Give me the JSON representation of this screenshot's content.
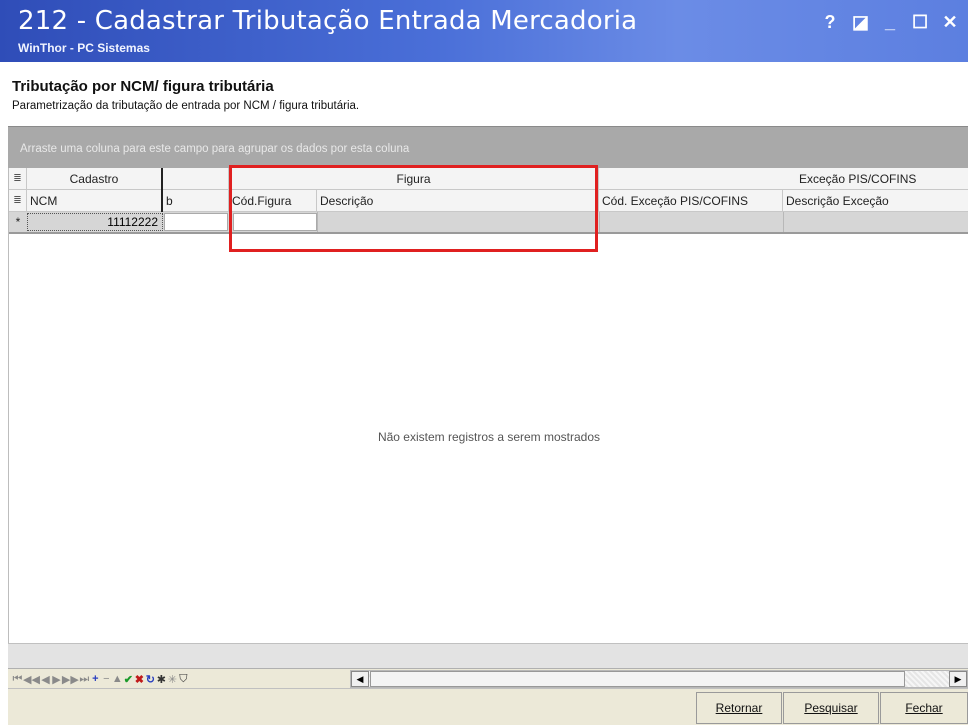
{
  "window": {
    "title": "212 - Cadastrar Tributação Entrada Mercadoria",
    "subtitle": "WinThor - PC Sistemas",
    "controls": {
      "help": "?",
      "restore": "◪",
      "minimize": "_",
      "maximize": "☐",
      "close": "✕"
    }
  },
  "header": {
    "heading": "Tributação por NCM/ figura tributária",
    "description": "Parametrização da tributação de entrada por NCM / figura tributária."
  },
  "group_panel": {
    "hint": "Arraste uma coluna para este campo para agrupar os dados por esta coluna"
  },
  "grid": {
    "bands": {
      "cadastro": "Cadastro",
      "figura": "Figura",
      "excecao": "Exceção PIS/COFINS"
    },
    "columns": {
      "ncm": "NCM",
      "col2": "b",
      "cod_figura": "Cód.Figura",
      "descricao": "Descrição",
      "cod_excecao": "Cód. Exceção PIS/COFINS",
      "descricao_excecao": "Descrição Exceção"
    },
    "new_row": {
      "indicator": "*",
      "ncm": "11112222"
    },
    "empty_message": "Não existem registros a serem mostrados"
  },
  "navigator": {
    "icons": [
      {
        "name": "first-icon",
        "glyph": "⏮",
        "color": "gray"
      },
      {
        "name": "prior-page-icon",
        "glyph": "◀◀",
        "color": "gray"
      },
      {
        "name": "prior-icon",
        "glyph": "◀",
        "color": "gray"
      },
      {
        "name": "next-icon",
        "glyph": "▶",
        "color": "gray"
      },
      {
        "name": "next-page-icon",
        "glyph": "▶▶",
        "color": "gray"
      },
      {
        "name": "last-icon",
        "glyph": "⏭",
        "color": "gray"
      },
      {
        "name": "insert-icon",
        "glyph": "+",
        "color": "blue"
      },
      {
        "name": "delete-icon",
        "glyph": "−",
        "color": "gray"
      },
      {
        "name": "edit-icon",
        "glyph": "▲",
        "color": "gray"
      },
      {
        "name": "post-icon",
        "glyph": "✔",
        "color": "green"
      },
      {
        "name": "cancel-icon",
        "glyph": "✖",
        "color": "red"
      },
      {
        "name": "refresh-icon",
        "glyph": "↻",
        "color": "blue"
      },
      {
        "name": "bookmark-icon",
        "glyph": "✱",
        "color": "dark"
      },
      {
        "name": "goto-bookmark-icon",
        "glyph": "✳",
        "color": "gray"
      },
      {
        "name": "filter-icon",
        "glyph": "⛉",
        "color": "dark"
      }
    ]
  },
  "buttons": {
    "retornar": "Retornar",
    "pesquisar": "Pesquisar",
    "fechar": "Fechar"
  },
  "colors": {
    "titlebar": "#3a58c8",
    "highlight": "#e02020",
    "group_bar": "#a9a9a9"
  }
}
